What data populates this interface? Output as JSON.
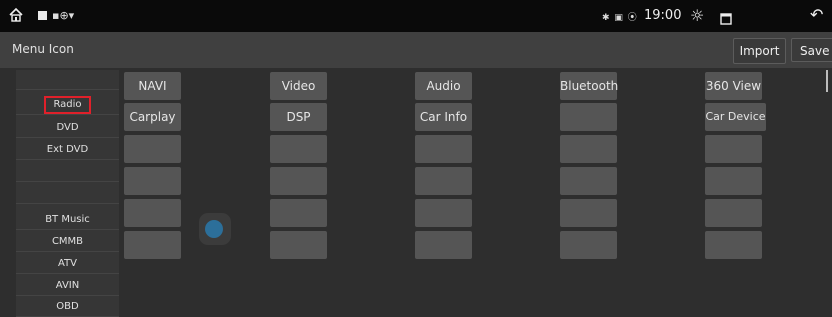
{
  "statusbar": {
    "small_icons": "▪⊕▾",
    "right_icons": "✱ ▣ ⦿",
    "time": "19:00"
  },
  "header": {
    "title": "Menu Icon",
    "import_label": "Import",
    "save_label": "Save"
  },
  "left_list": {
    "items": [
      "",
      "Radio",
      "DVD",
      "Ext DVD",
      "",
      "",
      "BT Music",
      "CMMB",
      "ATV",
      "AVIN",
      "OBD"
    ],
    "selected_index": 1
  },
  "grid": {
    "columns": [
      [
        "NAVI",
        "Carplay",
        "",
        "",
        "",
        ""
      ],
      [
        "Video",
        "DSP",
        "",
        "",
        "",
        ""
      ],
      [
        "Audio",
        "Car Info",
        "",
        "",
        "",
        ""
      ],
      [
        "Bluetooth",
        "",
        "",
        "",
        "",
        ""
      ],
      [
        "360 View",
        "Car Device",
        "",
        "",
        "",
        ""
      ]
    ]
  },
  "colors": {
    "background": "#2e2e2e",
    "statusbar": "#0a0a0a",
    "titlebar": "#404040",
    "tile": "#555555",
    "selection_outline": "#e0202a",
    "drag_dot": "#2c6f9a"
  }
}
